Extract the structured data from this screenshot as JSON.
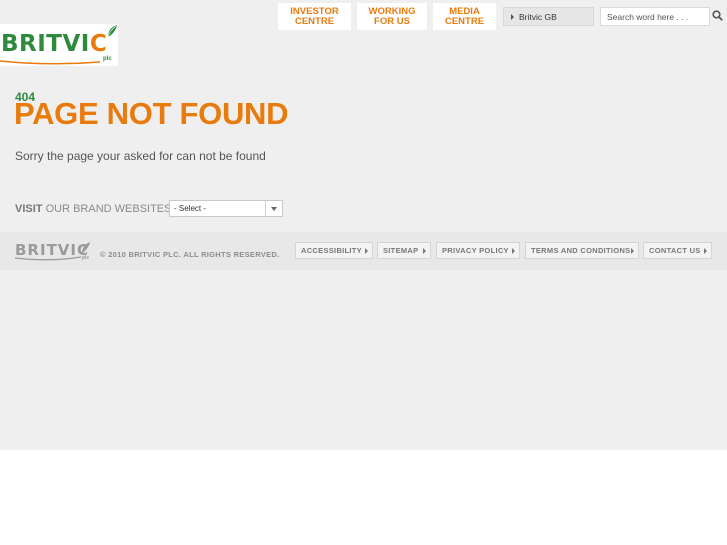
{
  "brand": {
    "logo_text": "BRITVIC",
    "logo_plc": "plc",
    "colors": {
      "green": "#2e8b3e",
      "orange": "#e97a0c"
    }
  },
  "nav": {
    "items": [
      {
        "line1": "INVESTOR",
        "line2": "CENTRE"
      },
      {
        "line1": "WORKING",
        "line2": "FOR US"
      },
      {
        "line1": "MEDIA",
        "line2": "CENTRE"
      }
    ],
    "region_select": "Britvic GB",
    "search_placeholder": "Search word here . . .",
    "search_icon": "search-icon"
  },
  "main": {
    "code": "404",
    "title": "PAGE NOT FOUND",
    "message": "Sorry the page your asked for can not be found",
    "visit_strong": "VISIT",
    "visit_rest": " OUR BRAND WEBSITES:",
    "brand_select_value": "- Select -"
  },
  "footer": {
    "logo_text": "BRITVIC",
    "logo_plc": "plc",
    "copyright": "© 2010 BRITVIC PLC. ALL RIGHTS RESERVED.",
    "links": [
      "ACCESSIBILITY",
      "SITEMAP",
      "PRIVACY POLICY",
      "TERMS AND CONDITIONS",
      "CONTACT US"
    ]
  }
}
